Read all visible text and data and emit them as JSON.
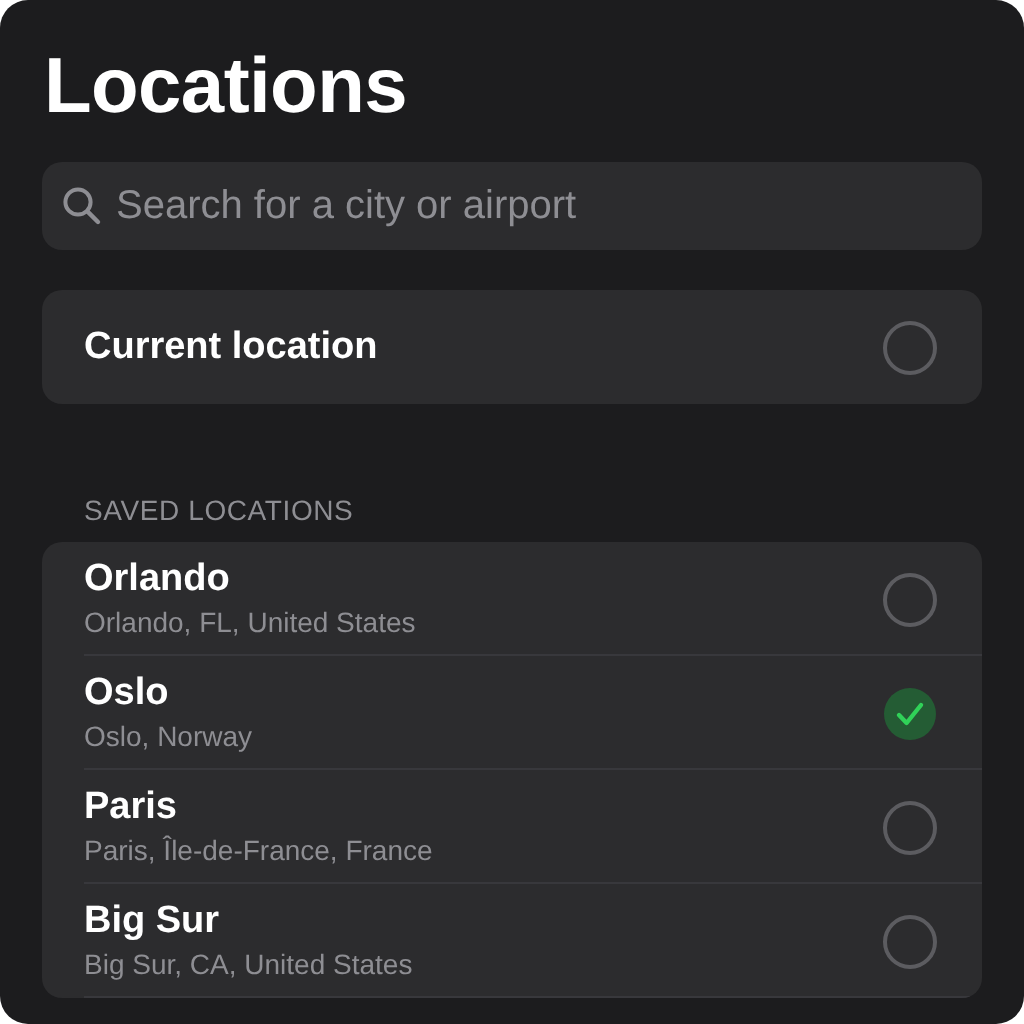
{
  "title": "Locations",
  "search": {
    "placeholder": "Search for a city or airport"
  },
  "current_location": {
    "label": "Current location",
    "selected": false
  },
  "section_header": "SAVED LOCATIONS",
  "saved_locations": [
    {
      "name": "Orlando",
      "detail": "Orlando, FL, United States",
      "selected": false
    },
    {
      "name": "Oslo",
      "detail": "Oslo, Norway",
      "selected": true
    },
    {
      "name": "Paris",
      "detail": "Paris, Île-de-France, France",
      "selected": false
    },
    {
      "name": "Big Sur",
      "detail": "Big Sur, CA, United States",
      "selected": false
    }
  ]
}
